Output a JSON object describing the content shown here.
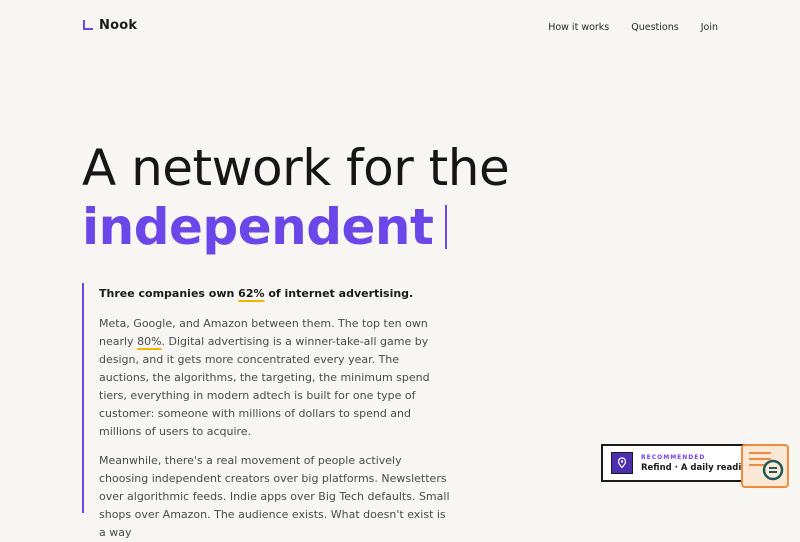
{
  "header": {
    "brand": "Nook",
    "nav": [
      "How it works",
      "Questions",
      "Join"
    ]
  },
  "hero": {
    "line1": "A network for the",
    "line2": "independent"
  },
  "article": {
    "lead_before": "Three companies own ",
    "lead_highlight": "62%",
    "lead_after": " of internet advertising.",
    "p1_before": "Meta, Google, and Amazon between them. The top ten own nearly ",
    "p1_highlight": "80%",
    "p1_after": ". Digital advertising is a winner-take-all game by design, and it gets more concentrated every year. The auctions, the algorithms, the targeting, the minimum spend tiers, everything in modern adtech is built for one type of customer: someone with millions of dollars to spend and millions of users to acquire.",
    "p2": "Meanwhile, there's a real movement of people actively choosing independent creators over big platforms. Newsletters over algorithmic feeds. Indie apps over Big Tech defaults. Small shops over Amazon. The audience exists. What doesn't exist is a way"
  },
  "widget": {
    "tag": "RECOMMENDED",
    "title": "Refind · A daily reading ne"
  },
  "colors": {
    "accent": "#6b46e8",
    "background": "#f7f6f2",
    "highlight": "#f2b705",
    "helper": "#f08a3e"
  },
  "icons": {
    "widget": "location-pin-icon",
    "helper": "search-document-icon"
  }
}
